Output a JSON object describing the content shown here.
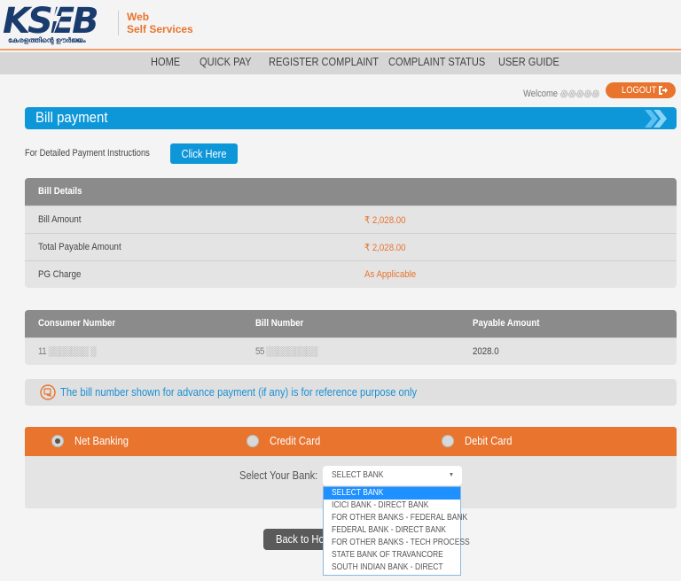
{
  "header": {
    "logo_text": "KSEB",
    "logo_tagline": "കേരളത്തിന്റെ ഊർജ്ജം",
    "brand_line1": "Web",
    "brand_line2": "Self Services"
  },
  "nav": {
    "items": [
      {
        "label": "HOME"
      },
      {
        "label": "QUICK PAY"
      },
      {
        "label": "REGISTER COMPLAINT"
      },
      {
        "label": "COMPLAINT STATUS"
      },
      {
        "label": "USER GUIDE"
      }
    ]
  },
  "user": {
    "welcome_label": "Welcome",
    "username_obscured": "꩜꩜꩜꩜꩜",
    "logout_label": "LOGOUT"
  },
  "page": {
    "title": "Bill payment",
    "instructions_text": "For Detailed Payment Instructions",
    "click_here_label": "Click Here"
  },
  "bill_details": {
    "header": "Bill Details",
    "rows": [
      {
        "label": "Bill Amount",
        "value": "₹ 2,028.00"
      },
      {
        "label": "Total Payable Amount",
        "value": "₹ 2,028.00"
      },
      {
        "label": "PG Charge",
        "value": "As Applicable"
      }
    ]
  },
  "consumer_table": {
    "columns": [
      "Consumer Number",
      "Bill Number",
      "Payable Amount"
    ],
    "row": {
      "consumer_number": "11 ░░░░░░░ ░",
      "bill_number": "55 ░░░░░░░░░",
      "payable_amount": "2028.0"
    }
  },
  "notice": {
    "text": "The bill number shown for advance payment (if any) is for reference purpose only"
  },
  "payment": {
    "methods": [
      {
        "label": "Net Banking",
        "selected": true
      },
      {
        "label": "Credit Card",
        "selected": false
      },
      {
        "label": "Debit Card",
        "selected": false
      }
    ],
    "select_label": "Select Your Bank:",
    "select_value": "SELECT BANK",
    "bank_options": [
      "SELECT BANK",
      "ICICI BANK - DIRECT BANK",
      "FOR OTHER BANKS - FEDERAL BANK",
      "FEDERAL BANK - DIRECT BANK",
      "FOR OTHER BANKS - TECH PROCESS",
      "STATE BANK OF TRAVANCORE",
      "SOUTH INDIAN BANK - DIRECT"
    ],
    "highlighted_option_index": 0
  },
  "back_button_label": "Back to Home",
  "colors": {
    "brand_orange": "#e8742e",
    "brand_blue": "#0d96d8",
    "logo_navy": "#1a3b6e",
    "table_header_gray": "#8b8b8b",
    "notice_text_blue": "#1a8fd4",
    "dropdown_highlight": "#1e90ff"
  }
}
